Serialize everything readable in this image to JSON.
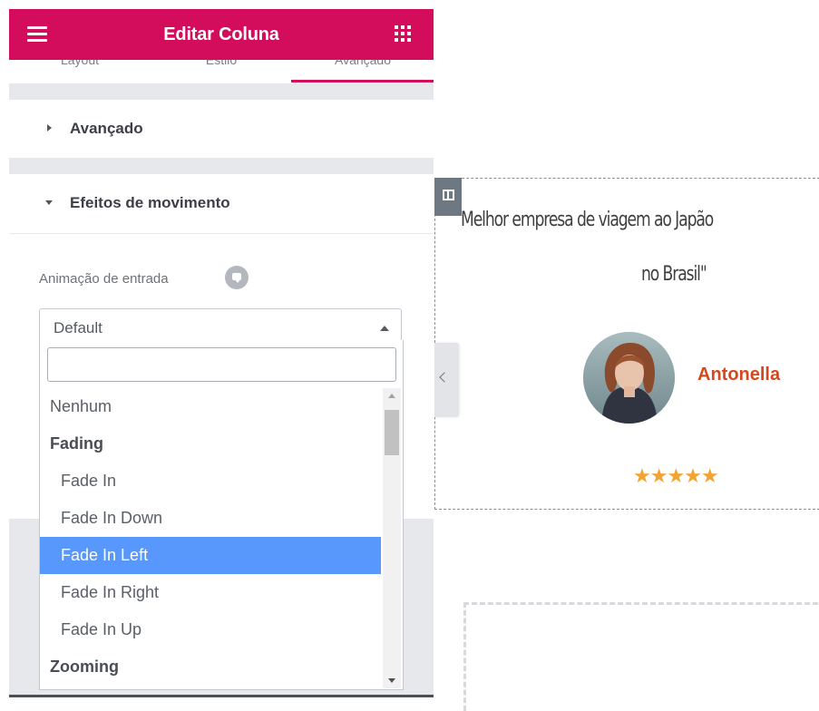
{
  "header": {
    "title": "Editar Coluna"
  },
  "tabs": [
    {
      "label": "Layout"
    },
    {
      "label": "Estilo"
    },
    {
      "label": "Avançado"
    }
  ],
  "sections": {
    "advanced": {
      "title": "Avançado"
    },
    "motion_effects": {
      "title": "Efeitos de movimento"
    }
  },
  "entrance_animation": {
    "label": "Animação de entrada",
    "value": "Default",
    "search": {
      "value": "",
      "placeholder": ""
    },
    "options": [
      {
        "label": "Nenhum"
      },
      {
        "label": "Fading"
      },
      {
        "label": "Fade In"
      },
      {
        "label": "Fade In Down"
      },
      {
        "label": "Fade In Left"
      },
      {
        "label": "Fade In Right"
      },
      {
        "label": "Fade In Up"
      },
      {
        "label": "Zooming"
      }
    ],
    "selected_option": "Fade In Left"
  },
  "canvas": {
    "quote_line_1": "Melhor empresa de viagem ao Japão",
    "quote_line_2": "no Brasil\"",
    "author_name": "Antonella",
    "stars": "★★★★★",
    "rating": 5,
    "rating_max": 5
  },
  "colors": {
    "brand": "#d30c5c",
    "selected_option": "#5897fb",
    "author_name": "#d5481f",
    "stars": "#f2a332"
  },
  "icons": {
    "menu": "hamburger-icon",
    "widgets": "grid-icon",
    "column_handle": "column-icon",
    "help": "comment-icon",
    "panel_toggle": "chevron-left-icon"
  }
}
